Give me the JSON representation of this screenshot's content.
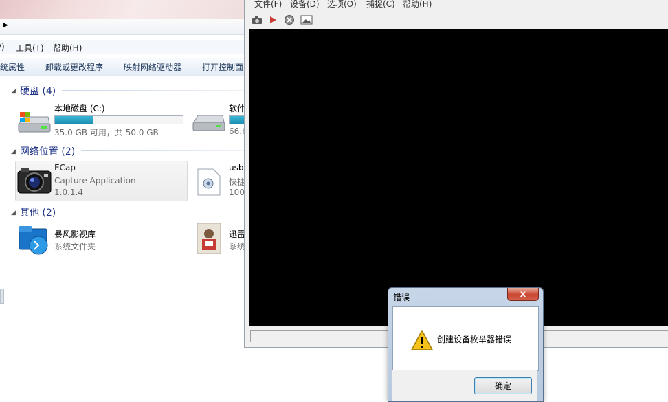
{
  "explorer": {
    "menu": [
      "/)",
      "工具(T)",
      "帮助(H)"
    ],
    "commands": [
      "统属性",
      "卸载或更改程序",
      "映射网络驱动器",
      "打开控制面"
    ],
    "groups": [
      {
        "label": "硬盘 (4)"
      },
      {
        "label": "网络位置 (2)"
      },
      {
        "label": "其他 (2)"
      }
    ],
    "drives": [
      {
        "name": "本地磁盘 (C:)",
        "detail": "35.0 GB 可用，共 50.0 GB",
        "used_fraction": 0.3
      },
      {
        "name": "软件",
        "detail": "66.6",
        "used_fraction": 0.9
      }
    ],
    "network": [
      {
        "name": "ECap",
        "line2": "Capture Application",
        "line3": "1.0.1.4"
      },
      {
        "name": "usb",
        "line2": "快捷",
        "line3": "100"
      }
    ],
    "other": [
      {
        "name": "暴风影视库",
        "detail": "系统文件夹"
      },
      {
        "name": "迅雷",
        "detail": "系统"
      }
    ]
  },
  "ecap": {
    "menu": [
      "文件(F)",
      "设备(D)",
      "选项(O)",
      "捕捉(C)",
      "帮助(H)"
    ],
    "toolbar_icons": [
      "camera-icon",
      "play-icon",
      "stop-icon",
      "picture-icon"
    ]
  },
  "dialog": {
    "title": "错误",
    "message": "创建设备枚举器错误",
    "ok_label": "确定",
    "close_label": "x"
  },
  "colors": {
    "video_bg": "#000000",
    "group_header": "#1e3287",
    "progress": "#2aa4c8"
  }
}
